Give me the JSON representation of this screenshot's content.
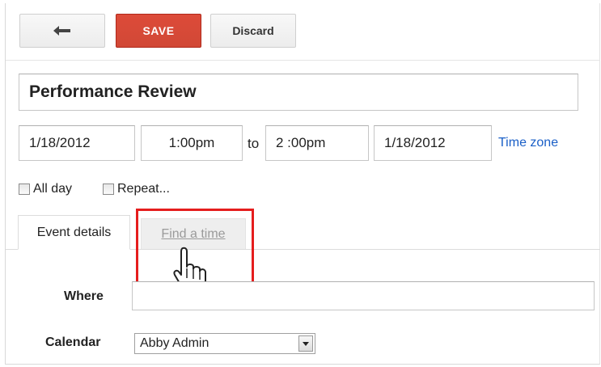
{
  "toolbar": {
    "back_icon": "back-arrow-icon",
    "save_label": "SAVE",
    "discard_label": "Discard"
  },
  "event": {
    "title": "Performance Review",
    "start_date": "1/18/2012",
    "start_time": "1:00pm",
    "to_label": "to",
    "end_time": "2 :00pm",
    "end_date": "1/18/2012",
    "time_zone_label": "Time zone"
  },
  "options": {
    "all_day_label": "All day",
    "repeat_label": "Repeat..."
  },
  "tabs": [
    {
      "label": "Event details",
      "active": true
    },
    {
      "label": "Find a time",
      "active": false
    }
  ],
  "details": {
    "where_label": "Where",
    "where_value": "",
    "calendar_label": "Calendar",
    "calendar_value": "Abby Admin"
  },
  "colors": {
    "save_button": "#d14836",
    "link": "#1a5fc7",
    "highlight": "#e51d1d"
  }
}
